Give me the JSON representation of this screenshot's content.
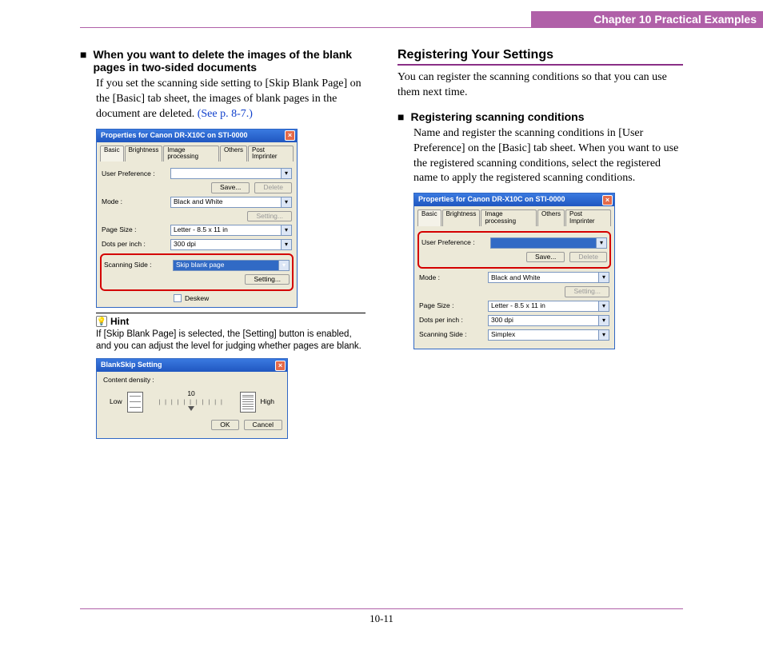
{
  "header": {
    "chapter": "Chapter 10   Practical Examples"
  },
  "left": {
    "heading": "When you want to delete the images of the blank pages in two-sided documents",
    "body_pre": "If you set the scanning side setting to [Skip Blank Page] on the [Basic] tab sheet, the images of blank pages in the document are deleted. ",
    "body_ref": "(See p. 8-7.)",
    "dialog1": {
      "title": "Properties for Canon DR-X10C on STI-0000",
      "tabs": [
        "Basic",
        "Brightness",
        "Image processing",
        "Others",
        "Post Imprinter"
      ],
      "rows": {
        "userpref_lbl": "User Preference :",
        "userpref_val": "",
        "save_btn": "Save...",
        "delete_btn": "Delete",
        "mode_lbl": "Mode :",
        "mode_val": "Black and White",
        "setting_btn": "Setting...",
        "page_lbl": "Page Size :",
        "page_val": "Letter - 8.5 x 11 in",
        "dpi_lbl": "Dots per inch :",
        "dpi_val": "300 dpi",
        "scan_lbl": "Scanning Side :",
        "scan_val": "Skip blank page",
        "setting2_btn": "Setting...",
        "deskew_lbl": "Deskew"
      }
    },
    "hint_label": "Hint",
    "hint_text": "If [Skip Blank Page] is selected, the [Setting] button is enabled, and you can adjust the level for judging whether pages are blank.",
    "dialog2": {
      "title": "BlankSkip Setting",
      "content_lbl": "Content density :",
      "low": "Low",
      "high": "High",
      "value": "10",
      "ok": "OK",
      "cancel": "Cancel"
    }
  },
  "right": {
    "section_title": "Registering Your Settings",
    "intro": "You can register the scanning conditions so that you can use them next time.",
    "heading": "Registering scanning conditions",
    "body": "Name and register the scanning conditions in [User Preference] on the [Basic] tab sheet. When you want to use the registered scanning conditions, select the registered name to apply the registered scanning conditions.",
    "dialog": {
      "title": "Properties for Canon DR-X10C on STI-0000",
      "tabs": [
        "Basic",
        "Brightness",
        "Image processing",
        "Others",
        "Post Imprinter"
      ],
      "rows": {
        "userpref_lbl": "User Preference :",
        "userpref_val": "",
        "save_btn": "Save...",
        "delete_btn": "Delete",
        "mode_lbl": "Mode :",
        "mode_val": "Black and White",
        "setting_btn": "Setting...",
        "page_lbl": "Page Size :",
        "page_val": "Letter - 8.5 x 11 in",
        "dpi_lbl": "Dots per inch :",
        "dpi_val": "300 dpi",
        "scan_lbl": "Scanning Side :",
        "scan_val": "Simplex"
      }
    }
  },
  "footer": {
    "page": "10-11"
  }
}
